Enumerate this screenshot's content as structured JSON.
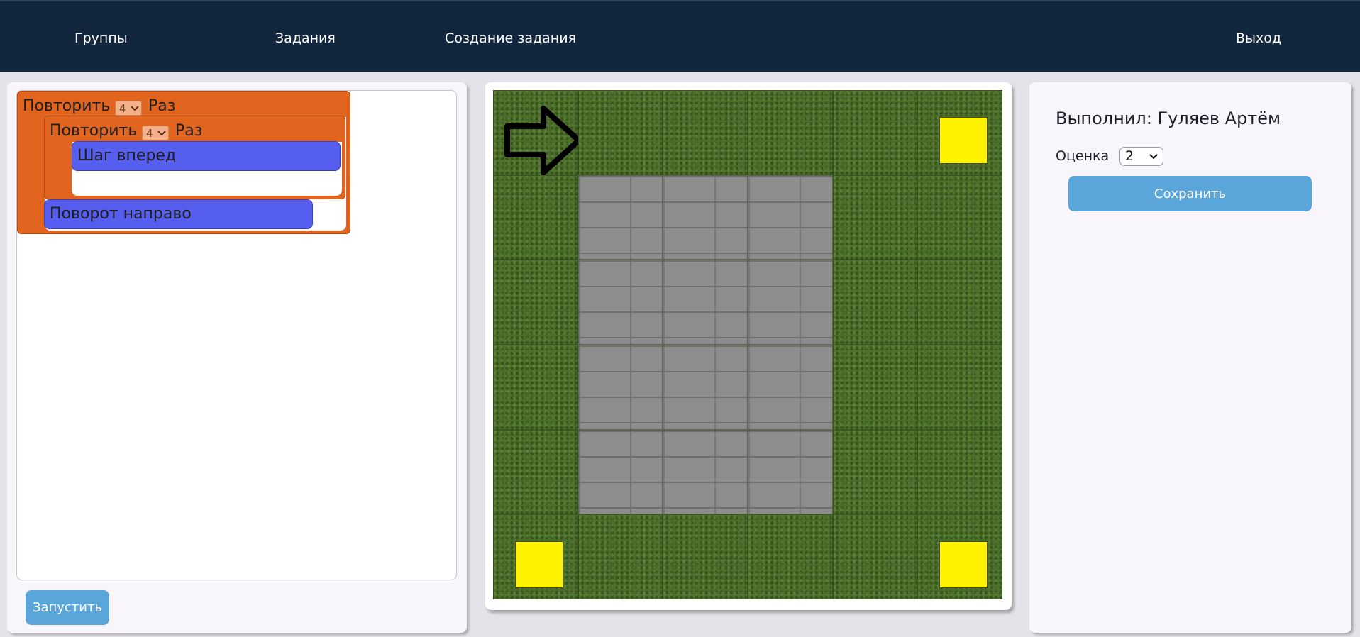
{
  "nav": {
    "groups": "Группы",
    "tasks": "Задания",
    "create_task": "Создание задания",
    "logout": "Выход"
  },
  "program": {
    "outer_repeat": {
      "label": "Повторить",
      "count": "4",
      "suffix": "Раз"
    },
    "inner_repeat": {
      "label": "Повторить",
      "count": "4",
      "suffix": "Раз"
    },
    "step_forward": "Шаг вперед",
    "turn_right": "Поворот направо"
  },
  "run_button": "Запустить",
  "board": {
    "rows": 6,
    "cols": 6,
    "paved_area": "rows 2-5, cols 2-4",
    "targets": [
      {
        "row": 1,
        "col": 6
      },
      {
        "row": 6,
        "col": 1
      },
      {
        "row": 6,
        "col": 6
      }
    ],
    "agent": {
      "row": 1,
      "col": 1,
      "direction": "right",
      "icon": "right-arrow-icon"
    },
    "colors": {
      "target": "#fff200",
      "grass": "#4a6e2a",
      "pavement": "#8d8d8d"
    }
  },
  "review": {
    "performed_by": "Выполнил: Гуляев Артём",
    "grade_label": "Оценка",
    "grade_value": "2",
    "save_button": "Сохранить"
  },
  "colors": {
    "header": "#12263e",
    "repeat_block": "#e2651f",
    "command_block": "#565ef0",
    "button": "#5aa5da"
  }
}
